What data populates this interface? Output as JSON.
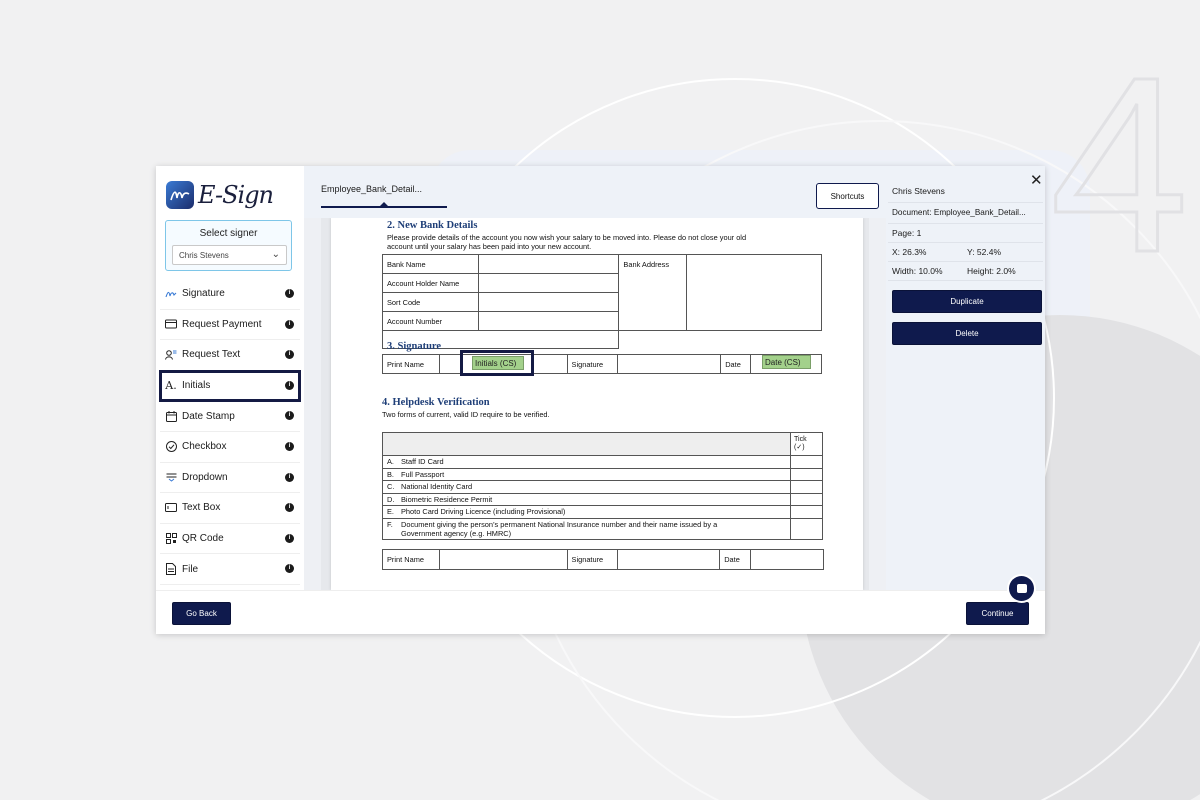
{
  "app": {
    "logo_text": "E-Sign",
    "background_numeral": "4"
  },
  "signer": {
    "label": "Select signer",
    "selected": "Chris Stevens"
  },
  "tools": [
    {
      "label": "Signature",
      "icon": "signature-icon"
    },
    {
      "label": "Request Payment",
      "icon": "credit-card-icon"
    },
    {
      "label": "Request Text",
      "icon": "user-text-icon"
    },
    {
      "label": "Initials",
      "icon": "initials-icon",
      "active": true
    },
    {
      "label": "Date Stamp",
      "icon": "calendar-icon"
    },
    {
      "label": "Checkbox",
      "icon": "checkbox-icon"
    },
    {
      "label": "Dropdown",
      "icon": "dropdown-icon"
    },
    {
      "label": "Text Box",
      "icon": "textbox-icon"
    },
    {
      "label": "QR Code",
      "icon": "qr-code-icon"
    },
    {
      "label": "File",
      "icon": "file-icon"
    }
  ],
  "tab": {
    "document_name": "Employee_Bank_Detail...",
    "shortcuts_label": "Shortcuts"
  },
  "document": {
    "section2_title": "2. New Bank Details",
    "section2_text_1": "Please provide details of the account you now wish your salary to be moved into.  Please do not close your old",
    "section2_text_2": "account until your salary has been paid into your new account.",
    "bank_rows": [
      "Bank Name",
      "Account Holder Name",
      "Sort Code",
      "Account Number"
    ],
    "bank_address_label": "Bank Address",
    "section3_title": "3. Signature",
    "sig_print_name": "Print Name",
    "sig_signature": "Signature",
    "sig_date": "Date",
    "initials_field": "Initials (CS)",
    "date_field": "Date (CS)",
    "section4_title": "4. Helpdesk Verification",
    "section4_text": "Two forms of current, valid ID require to be verified.",
    "tick_header_1": "Tick",
    "tick_header_2": "(✓)",
    "id_rows": [
      {
        "letter": "A.",
        "text": "Staff ID Card"
      },
      {
        "letter": "B.",
        "text": "Full Passport"
      },
      {
        "letter": "C.",
        "text": "National Identity Card"
      },
      {
        "letter": "D.",
        "text": "Biometric Residence Permit"
      },
      {
        "letter": "E.",
        "text": "Photo Card Driving Licence (including Provisional)"
      },
      {
        "letter": "F.",
        "text": "Document giving the person’s permanent National Insurance number and their name issued by a",
        "text2": "Government agency (e.g. HMRC)"
      }
    ],
    "verify_print_name": "Print Name",
    "verify_signature": "Signature",
    "verify_date": "Date"
  },
  "properties": {
    "signer_name": "Chris Stevens",
    "document": "Document: Employee_Bank_Detail...",
    "page": "Page: 1",
    "x": "X: 26.3%",
    "y": "Y: 52.4%",
    "width": "Width: 10.0%",
    "height": "Height: 2.0%",
    "duplicate_label": "Duplicate",
    "delete_label": "Delete"
  },
  "footer": {
    "go_back_label": "Go Back",
    "continue_label": "Continue"
  },
  "colors": {
    "primary": "#0f1a4d",
    "field_green": "#a3d18b",
    "heading_blue": "#1f3f78",
    "signer_border": "#7ec6e8"
  }
}
